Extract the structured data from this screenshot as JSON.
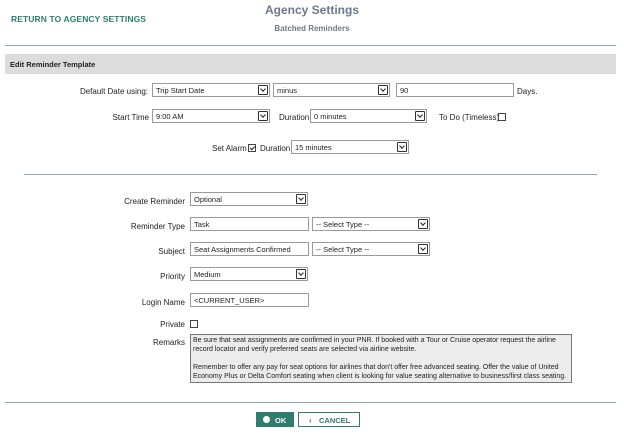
{
  "header": {
    "return_link": "RETURN TO AGENCY SETTINGS",
    "title": "Agency Settings",
    "subtitle": "Batched Reminders"
  },
  "section": {
    "title": "Edit Reminder Template"
  },
  "default_date": {
    "label": "Default Date using:",
    "basis": "Trip Start Date",
    "direction": "minus",
    "days_value": "90",
    "days_label": "Days."
  },
  "start_time": {
    "label": "Start Time",
    "value": "9:00 AM",
    "duration_label": "Duration",
    "duration_value": "0 minutes",
    "todo_label": "To Do (Timeless)",
    "todo_checked": false
  },
  "alarm": {
    "label": "Set Alarm",
    "checked": true,
    "duration_label": "Duration",
    "duration_value": "15 minutes"
  },
  "reminder": {
    "create_label": "Create Reminder",
    "create_value": "Optional",
    "type_label": "Reminder Type",
    "type_value": "Task",
    "type_select": "-- Select Type --",
    "subject_label": "Subject",
    "subject_value": "Seat Assignments Confirmed",
    "subject_select": "-- Select Type --",
    "priority_label": "Priority",
    "priority_value": "Medium",
    "login_label": "Login Name",
    "login_value": "<CURRENT_USER>",
    "private_label": "Private",
    "private_checked": false,
    "remarks_label": "Remarks",
    "remarks_p1": "Be sure that seat assignments are confirmed in your PNR.  If booked with a Tour or Cruise operator request the airline record locator and verify preferred seats are selected via airline website.",
    "remarks_p2": "Remember to offer any pay for seat options for airlines that don't offer free advanced seating.  Offer the value of United Economy Plus or Delta Comfort seating when client is looking for value seating alternative to business/first class seating."
  },
  "buttons": {
    "ok": "OK",
    "cancel": "CANCEL"
  },
  "colors": {
    "accent": "#2e7d6e",
    "title": "#6c7a89",
    "section_bg": "#dcdcdc"
  }
}
